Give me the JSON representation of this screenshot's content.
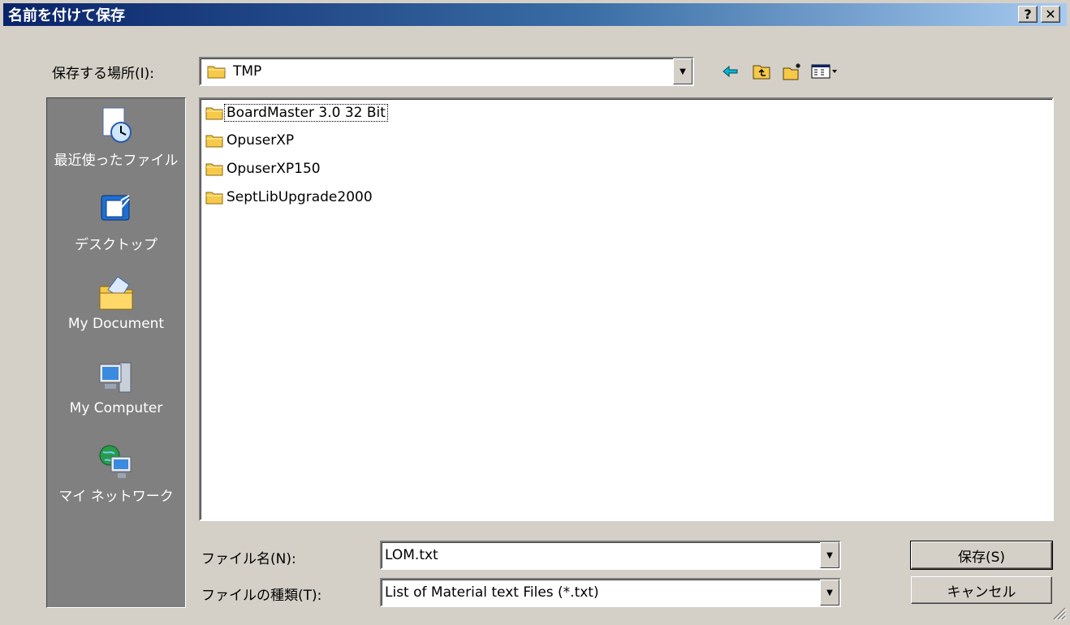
{
  "window": {
    "title": "名前を付けて保存",
    "help_glyph": "?",
    "close_glyph": "✕"
  },
  "lookin": {
    "label": "保存する場所(I):",
    "value": "TMP"
  },
  "toolbar": {
    "icons": [
      "back-icon",
      "up-folder-icon",
      "new-folder-icon",
      "view-menu-icon"
    ]
  },
  "places": [
    {
      "label": "最近使ったファイル",
      "icon": "recent-files-icon"
    },
    {
      "label": "デスクトップ",
      "icon": "desktop-icon"
    },
    {
      "label": "My Document",
      "icon": "my-documents-icon"
    },
    {
      "label": "My Computer",
      "icon": "my-computer-icon"
    },
    {
      "label": "マイ ネットワーク",
      "icon": "network-icon"
    }
  ],
  "files": [
    {
      "name": "BoardMaster 3.0 32 Bit",
      "focused": true
    },
    {
      "name": "OpuserXP",
      "focused": false
    },
    {
      "name": "OpuserXP150",
      "focused": false
    },
    {
      "name": "SeptLibUpgrade2000",
      "focused": false
    }
  ],
  "filename": {
    "label": "ファイル名(N):",
    "value": "LOM.txt"
  },
  "filetype": {
    "label": "ファイルの種類(T):",
    "value": "List of Material text Files (*.txt)"
  },
  "buttons": {
    "save": "保存(S)",
    "cancel": "キャンセル"
  },
  "colors": {
    "title_start": "#0a246a",
    "title_end": "#a6caf0",
    "face": "#d4d0c8",
    "places_bg": "#808080",
    "folder": "#f6c94a"
  }
}
